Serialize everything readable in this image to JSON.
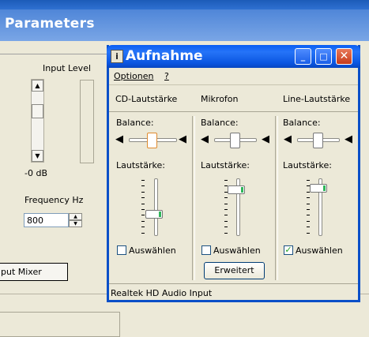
{
  "background": {
    "header_title": "Parameters",
    "input_level_label": "Input Level",
    "db_label": "-0 dB",
    "frequency_label": "Frequency Hz",
    "frequency_value": "800",
    "input_mixer_button": "put Mixer"
  },
  "window": {
    "title": "Aufnahme",
    "icon_glyph": "i",
    "menu": [
      "Optionen",
      "?"
    ],
    "balance_label": "Balance:",
    "volume_label": "Lautstärke:",
    "select_label": "Auswählen",
    "channels": [
      {
        "name": "CD-Lautstärke",
        "volume_level": 0.34,
        "selected": false
      },
      {
        "name": "Mikrofon",
        "volume_level": 0.85,
        "selected": false,
        "extra_button": "Erweitert"
      },
      {
        "name": "Line-Lautstärke",
        "volume_level": 0.88,
        "selected": true
      }
    ],
    "status": "Realtek HD Audio Input"
  },
  "colors": {
    "titlebar": "#0a5ff3",
    "close_button": "#c63b1b",
    "slider_accent": "#2fb65a",
    "checkmark": "#21a121"
  },
  "icons": {
    "speaker_left": "speaker-left-icon",
    "speaker_right": "speaker-right-icon"
  }
}
